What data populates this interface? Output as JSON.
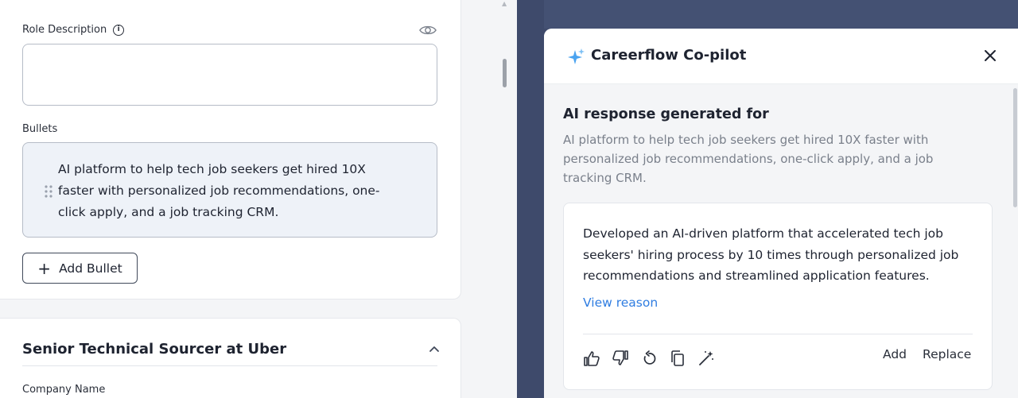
{
  "form": {
    "role_description_label": "Role Description",
    "bullets_label": "Bullets",
    "bullet_text": "AI platform to help tech job seekers get hired 10X faster with personalized job recommendations, one-click apply, and a job tracking CRM.",
    "add_bullet_label": "Add Bullet",
    "section_title": "Senior Technical Sourcer at Uber",
    "company_name_label": "Company Name"
  },
  "copilot": {
    "title": "Careerflow Co-pilot",
    "response_heading": "AI response generated for",
    "response_source": "AI platform to help tech job seekers get hired 10X faster with personalized job recommendations, one-click apply, and a job tracking CRM.",
    "generated_text": "Developed an AI-driven platform that accelerated tech job seekers' hiring process by 10 times through personalized job recommendations and streamlined application features.",
    "view_reason_label": "View reason",
    "add_label": "Add",
    "replace_label": "Replace"
  },
  "icons": [
    "info-icon",
    "eye-icon",
    "drag-handle-icon",
    "plus-icon",
    "chevron-up-icon",
    "sparkle-icon",
    "close-icon",
    "thumbs-up-icon",
    "thumbs-down-icon",
    "regenerate-icon",
    "copy-icon",
    "magic-wand-icon"
  ],
  "colors": {
    "accent": "#2f7de1",
    "overlay": "#3e4a6b",
    "bullet_bg": "#eef2f8"
  }
}
